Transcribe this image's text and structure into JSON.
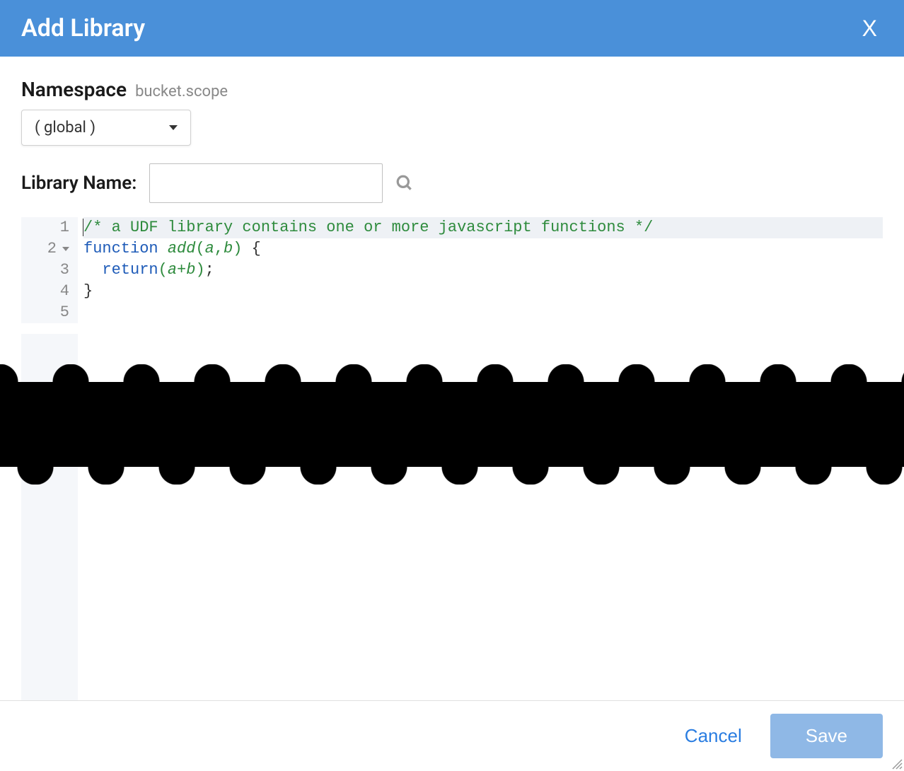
{
  "header": {
    "title": "Add Library",
    "close": "X"
  },
  "namespace": {
    "label": "Namespace",
    "hint": "bucket.scope",
    "selected": "( global )"
  },
  "library_name": {
    "label": "Library Name:",
    "value": ""
  },
  "editor": {
    "line_numbers": [
      "1",
      "2",
      "3",
      "4",
      "5"
    ],
    "code": {
      "line1_comment": "/* a UDF library contains one or more javascript functions */",
      "line2": {
        "keyword": "function",
        "name": "add",
        "open_paren": "(",
        "param_a": "a",
        "comma": ",",
        "param_b": "b",
        "close_paren": ")",
        "brace": " {"
      },
      "line3": {
        "indent": "  ",
        "keyword": "return",
        "open_paren": "(",
        "var_a": "a",
        "op": "+",
        "var_b": "b",
        "close_paren": ")",
        "semi": ";"
      },
      "line4": "}",
      "line5": ""
    }
  },
  "footer": {
    "cancel": "Cancel",
    "save": "Save"
  }
}
